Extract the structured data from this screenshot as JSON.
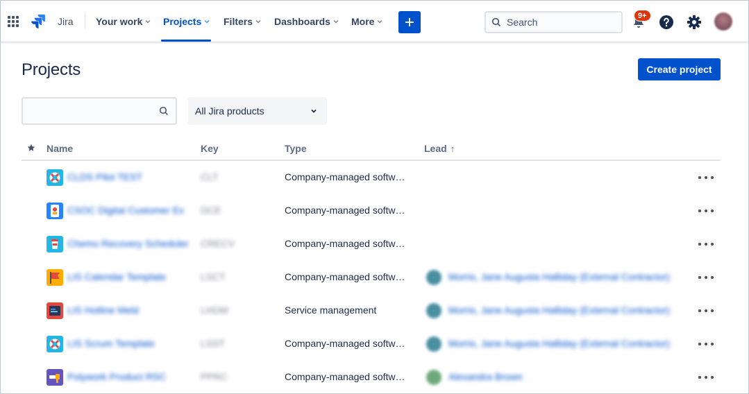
{
  "nav": {
    "brand": "Jira",
    "items": [
      {
        "label": "Your work",
        "active": false
      },
      {
        "label": "Projects",
        "active": true
      },
      {
        "label": "Filters",
        "active": false
      },
      {
        "label": "Dashboards",
        "active": false
      },
      {
        "label": "More",
        "active": false
      }
    ],
    "search_placeholder": "Search",
    "notifications_badge": "9+",
    "accent_color": "#0052cc",
    "badge_color": "#de350b"
  },
  "page": {
    "title": "Projects",
    "create_button": "Create project",
    "product_filter": "All Jira products"
  },
  "table": {
    "headers": {
      "name": "Name",
      "key": "Key",
      "type": "Type",
      "lead": "Lead",
      "sort_indicator": "↑"
    },
    "rows": [
      {
        "name": "CLDS Pilot TEST",
        "key": "CLT",
        "type": "Company-managed softw…",
        "icon": "lifebuoy-icon",
        "lead": "",
        "lead_avatar_color": ""
      },
      {
        "name": "CSOC Digital Customer Ex",
        "key": "DCE",
        "type": "Company-managed softw…",
        "icon": "phone-screen-icon",
        "lead": "",
        "lead_avatar_color": ""
      },
      {
        "name": "Chemo Recovery Scheduler",
        "key": "CRECV",
        "type": "Company-managed softw…",
        "icon": "coffee-cup-icon",
        "lead": "",
        "lead_avatar_color": ""
      },
      {
        "name": "LIS Calendar Template",
        "key": "LSCT",
        "type": "Company-managed softw…",
        "icon": "flag-icon",
        "lead": "Morris, Jane Augusta Halliday (External Contractor)",
        "lead_avatar_color": "#4a8fa0"
      },
      {
        "name": "LIS Hotline Meld",
        "key": "LHDM",
        "type": "Service management",
        "icon": "terminal-icon",
        "lead": "Morris, Jane Augusta Halliday (External Contractor)",
        "lead_avatar_color": "#4a8fa0"
      },
      {
        "name": "LIS Scrum Template",
        "key": "LSST",
        "type": "Company-managed softw…",
        "icon": "lifebuoy-icon",
        "lead": "Morris, Jane Augusta Halliday (External Contractor)",
        "lead_avatar_color": "#4a8fa0"
      },
      {
        "name": "Polywork Product RSC",
        "key": "PPRC",
        "type": "Company-managed softw…",
        "icon": "drill-icon",
        "lead": "Alexandra Brown",
        "lead_avatar_color": "#6ea87a"
      }
    ]
  }
}
